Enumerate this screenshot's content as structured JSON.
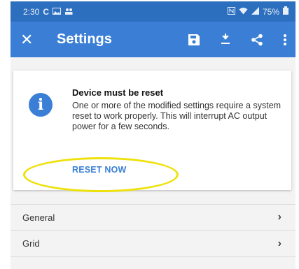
{
  "status_bar": {
    "time": "2:30",
    "carrier_glyph": "C",
    "battery": "75%",
    "colors": {
      "background": "#2d6fbf"
    }
  },
  "app_bar": {
    "close_glyph": "✕",
    "title": "Settings",
    "icons": [
      "save-icon",
      "download-icon",
      "share-icon",
      "more-vert-icon"
    ],
    "colors": {
      "background": "#3a7fd5",
      "foreground": "#ffffff"
    }
  },
  "alert_card": {
    "icon_glyph": "i",
    "title": "Device must be reset",
    "body": "One or more of the modified settings require a system reset to work properly. This will interrupt AC output power for a few seconds.",
    "action_label": "RESET NOW",
    "colors": {
      "accent": "#3a7fd5",
      "highlight": "#eee10a"
    }
  },
  "settings_list": {
    "items": [
      {
        "label": "General",
        "chevron": "›"
      },
      {
        "label": "Grid",
        "chevron": "›"
      }
    ]
  }
}
